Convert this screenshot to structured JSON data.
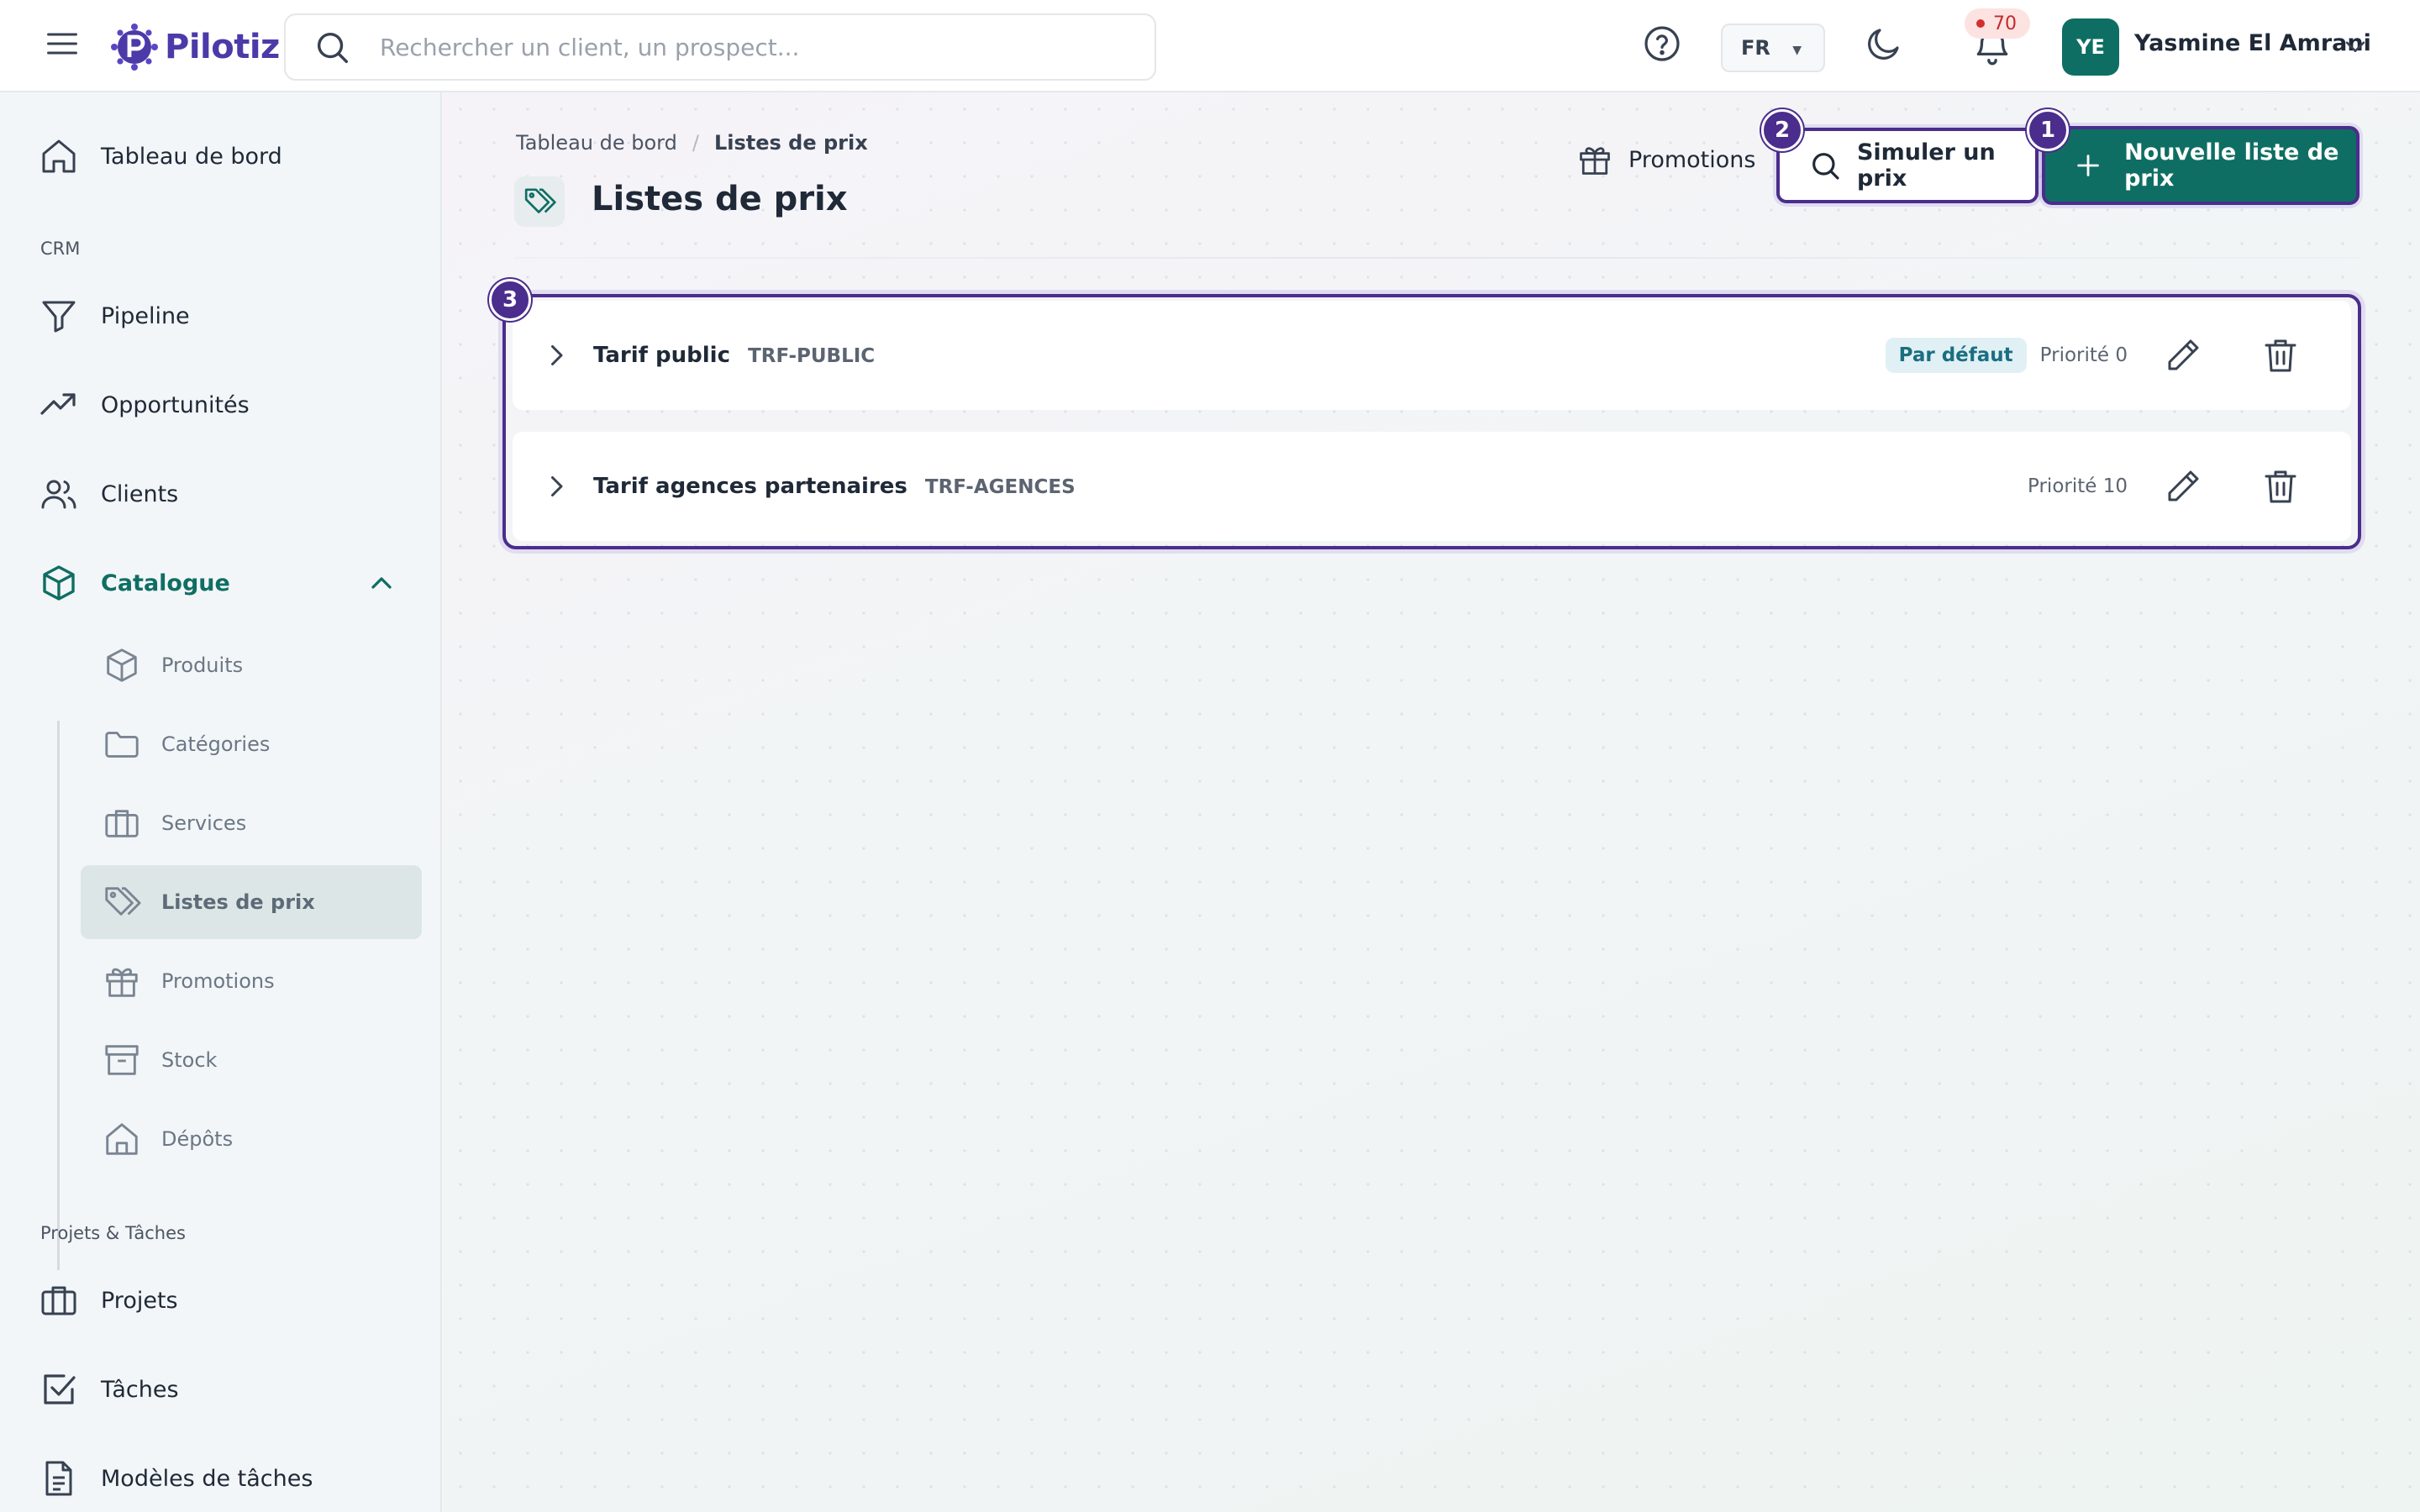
{
  "app": {
    "brand": "Pilotiz"
  },
  "topbar": {
    "search_placeholder": "Rechercher un client, un prospect...",
    "language": "FR",
    "notifications_count": "70",
    "user_initials": "YE",
    "user_name": "Yasmine El Amrani"
  },
  "sidebar": {
    "dashboard": "Tableau de bord",
    "section_crm": "CRM",
    "pipeline": "Pipeline",
    "opportunities": "Opportunités",
    "clients": "Clients",
    "catalogue": "Catalogue",
    "catalogue_items": [
      {
        "label": "Produits",
        "icon": "cube-icon"
      },
      {
        "label": "Catégories",
        "icon": "folder-icon"
      },
      {
        "label": "Services",
        "icon": "briefcase-icon"
      },
      {
        "label": "Listes de prix",
        "icon": "tags-icon"
      },
      {
        "label": "Promotions",
        "icon": "gift-icon"
      },
      {
        "label": "Stock",
        "icon": "archive-icon"
      },
      {
        "label": "Dépôts",
        "icon": "warehouse-icon"
      }
    ],
    "section_projects": "Projets & Tâches",
    "projects": "Projets",
    "tasks": "Tâches",
    "task_templates": "Modèles de tâches"
  },
  "page": {
    "breadcrumb_root": "Tableau de bord",
    "breadcrumb_current": "Listes de prix",
    "title": "Listes de prix",
    "promotions_link": "Promotions",
    "simulate_button": "Simuler un prix",
    "new_button": "Nouvelle liste de prix"
  },
  "annotations": {
    "badge_new": "1",
    "badge_simulate": "2",
    "badge_list": "3"
  },
  "price_lists": [
    {
      "name": "Tarif public",
      "code": "TRF-PUBLIC",
      "default_label": "Par défaut",
      "priority": "Priorité 0"
    },
    {
      "name": "Tarif agences partenaires",
      "code": "TRF-AGENCES",
      "priority": "Priorité 10"
    }
  ],
  "colors": {
    "brand": "#4b3aa8",
    "accent": "#0f6e63",
    "highlight": "#4a2d8c",
    "badge_bg": "#fde2e2"
  }
}
